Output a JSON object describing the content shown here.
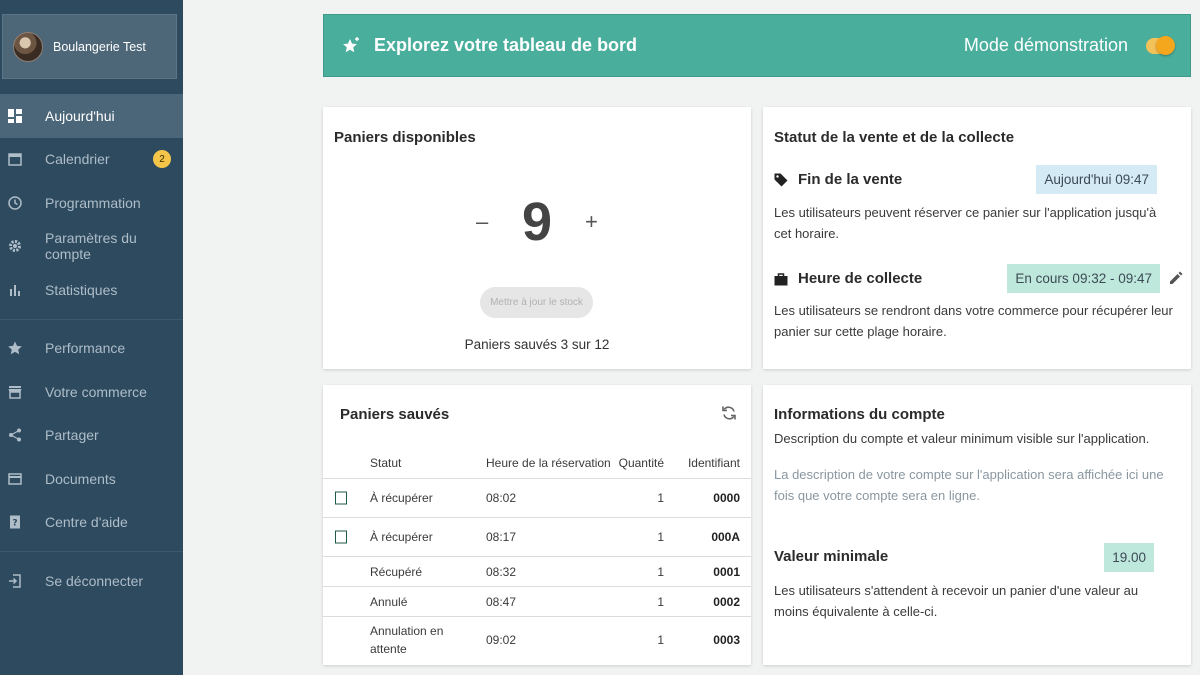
{
  "sidebar": {
    "profile_name": "Boulangerie Test",
    "items": [
      {
        "label": "Aujourd'hui"
      },
      {
        "label": "Calendrier",
        "badge": "2"
      },
      {
        "label": "Programmation"
      },
      {
        "label": "Paramètres du compte"
      },
      {
        "label": "Statistiques"
      },
      {
        "label": "Performance"
      },
      {
        "label": "Votre commerce"
      },
      {
        "label": "Partager"
      },
      {
        "label": "Documents"
      },
      {
        "label": "Centre d'aide"
      },
      {
        "label": "Se déconnecter"
      }
    ]
  },
  "banner": {
    "title": "Explorez votre tableau de bord",
    "demo_label": "Mode démonstration",
    "demo_on": true
  },
  "available": {
    "title": "Paniers disponibles",
    "minus": "–",
    "count": "9",
    "plus": "+",
    "button": "Mettre à jour le stock",
    "saved_text": "Paniers sauvés 3 sur 12"
  },
  "status": {
    "title": "Statut de la vente et de la collecte",
    "end_label": "Fin de la vente",
    "end_value": "Aujourd'hui 09:47",
    "end_desc": "Les utilisateurs peuvent réserver ce panier sur l'application jusqu'à cet horaire.",
    "pickup_label": "Heure de collecte",
    "pickup_value": "En cours 09:32 - 09:47",
    "pickup_desc": "Les utilisateurs se rendront dans votre commerce pour récupérer leur panier sur cette plage horaire."
  },
  "saved": {
    "title": "Paniers sauvés",
    "columns": [
      "Statut",
      "Heure de la réservation",
      "Quantité",
      "Identifiant"
    ],
    "rows": [
      {
        "status": "À récupérer",
        "time": "08:02",
        "qty": "1",
        "id": "0000"
      },
      {
        "status": "À récupérer",
        "time": "08:17",
        "qty": "1",
        "id": "000A"
      },
      {
        "status": "Récupéré",
        "time": "08:32",
        "qty": "1",
        "id": "0001"
      },
      {
        "status": "Annulé",
        "time": "08:47",
        "qty": "1",
        "id": "0002"
      },
      {
        "status": "Annulation en attente",
        "time": "09:02",
        "qty": "1",
        "id": "0003"
      }
    ]
  },
  "account": {
    "title": "Informations du compte",
    "subtitle": "Description du compte et valeur minimum visible sur l'application.",
    "placeholder": "La description de votre compte sur l'application sera affichée ici une fois que votre compte sera en ligne.",
    "min_label": "Valeur minimale",
    "min_value": "19.00",
    "min_desc": "Les utilisateurs s'attendent à recevoir un panier d'une valeur au moins équivalente à celle-ci."
  },
  "colors": {
    "sidebar": "#2e4a5f",
    "banner": "#4aae9c",
    "toggle": "#f4a61c",
    "badge": "#f5c54a"
  }
}
